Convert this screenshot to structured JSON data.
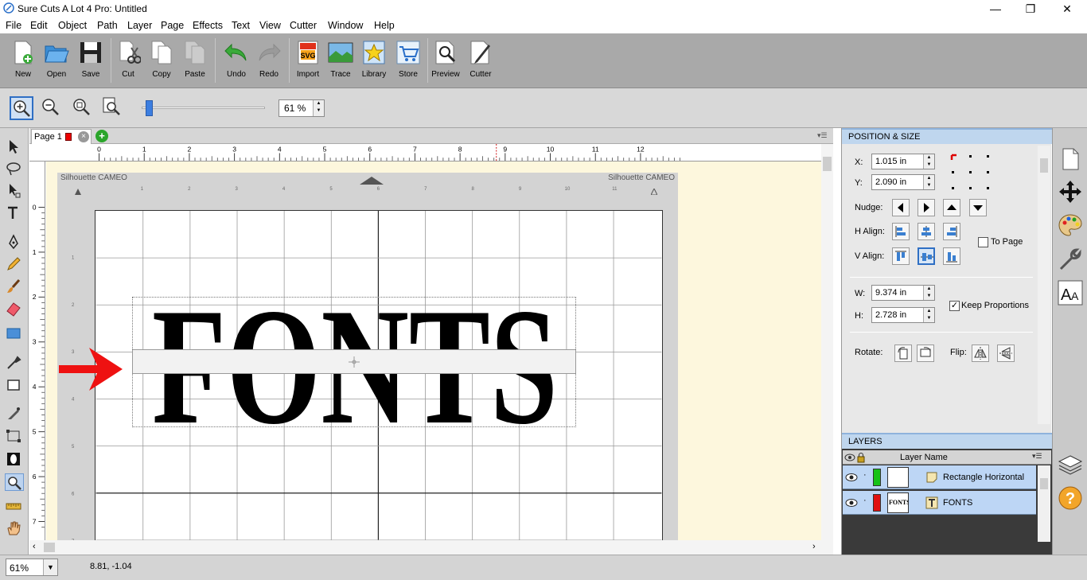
{
  "window": {
    "title": "Sure Cuts A Lot 4 Pro: Untitled",
    "minimize": "—",
    "maximize": "❐",
    "close": "✕"
  },
  "menu": [
    "File",
    "Edit",
    "Object",
    "Path",
    "Layer",
    "Page",
    "Effects",
    "Text",
    "View",
    "Cutter",
    "Window",
    "Help"
  ],
  "toolbar": {
    "buttons": [
      {
        "label": "New",
        "icon": "new-document-icon"
      },
      {
        "label": "Open",
        "icon": "open-folder-icon"
      },
      {
        "label": "Save",
        "icon": "save-disk-icon"
      },
      {
        "label": "Cut",
        "icon": "scissors-icon"
      },
      {
        "label": "Copy",
        "icon": "copy-icon"
      },
      {
        "label": "Paste",
        "icon": "paste-icon"
      },
      {
        "label": "Undo",
        "icon": "undo-icon"
      },
      {
        "label": "Redo",
        "icon": "redo-icon"
      },
      {
        "label": "Import",
        "icon": "import-svg-icon"
      },
      {
        "label": "Trace",
        "icon": "trace-icon"
      },
      {
        "label": "Library",
        "icon": "library-star-icon"
      },
      {
        "label": "Store",
        "icon": "store-cart-icon"
      },
      {
        "label": "Preview",
        "icon": "preview-magnifier-icon"
      },
      {
        "label": "Cutter",
        "icon": "cutter-pen-icon"
      }
    ],
    "svg_badge": "SVG"
  },
  "zoom": {
    "value": "61 %",
    "slider_fraction": 0.06
  },
  "page_tab": {
    "label": "Page 1",
    "add": "+",
    "close": "×"
  },
  "ruler": {
    "h_ticks": [
      "0",
      "1",
      "2",
      "3",
      "4",
      "5",
      "6",
      "7",
      "8",
      "9",
      "10",
      "11",
      "12"
    ],
    "v_ticks": [
      "0",
      "1",
      "2",
      "3",
      "4",
      "5",
      "6",
      "7"
    ],
    "mat_h_ticks": [
      "1",
      "2",
      "3",
      "4",
      "5",
      "6",
      "7",
      "8",
      "9",
      "10",
      "11"
    ],
    "mat_v_ticks": [
      "1",
      "2",
      "3",
      "4",
      "5",
      "6",
      "7"
    ]
  },
  "mat": {
    "brand_left": "Silhouette CAMEO",
    "brand_right": "Silhouette CAMEO"
  },
  "design": {
    "text": "FONTS"
  },
  "position_size": {
    "header": "POSITION & SIZE",
    "x_label": "X:",
    "x_value": "1.015 in",
    "y_label": "Y:",
    "y_value": "2.090 in",
    "nudge_label": "Nudge:",
    "halign_label": "H Align:",
    "valign_label": "V Align:",
    "to_page_label": "To Page",
    "to_page_checked": false,
    "w_label": "W:",
    "w_value": "9.374 in",
    "h_label": "H:",
    "h_value": "2.728 in",
    "keep_proportions_label": "Keep Proportions",
    "keep_proportions_checked": true,
    "rotate_label": "Rotate:",
    "flip_label": "Flip:"
  },
  "layers": {
    "header": "LAYERS",
    "column": "Layer Name",
    "rows": [
      {
        "name": "Rectangle Horizontal",
        "color": "#17c217",
        "thumb": ""
      },
      {
        "name": "FONTS",
        "color": "#e01010",
        "thumb": "FONTS"
      }
    ]
  },
  "status": {
    "zoom": "61%",
    "coords": "8.81, -1.04"
  },
  "colors": {
    "accent": "#2f6fc4",
    "arrow": "#ee1111",
    "toolbar_bg": "#a9a9a9",
    "canvas_bg": "#fdf7dd"
  }
}
